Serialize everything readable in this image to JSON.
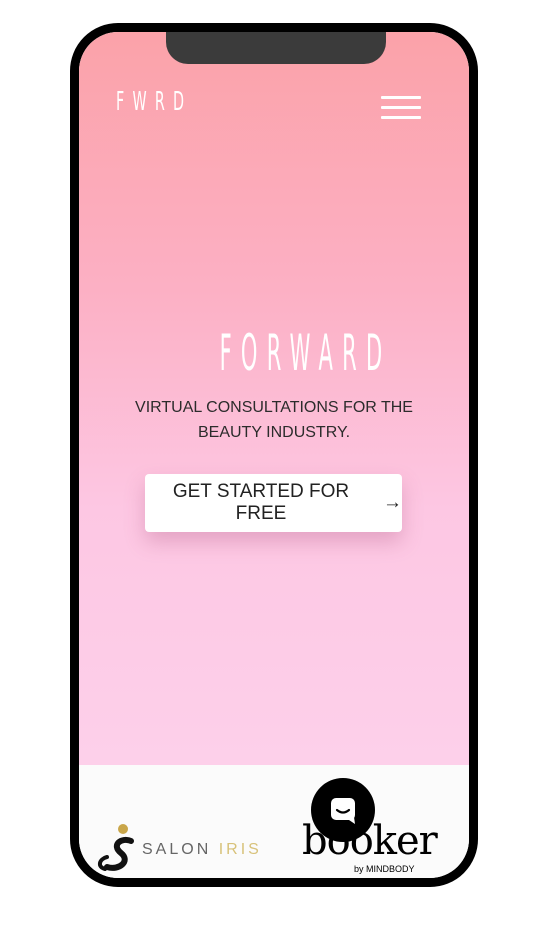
{
  "header": {
    "logo": "FWRD",
    "menu_icon": "hamburger-menu-icon"
  },
  "hero": {
    "title": "FORWARD",
    "tagline_line1": "VIRTUAL CONSULTATIONS FOR THE",
    "tagline_line2": "BEAUTY INDUSTRY.",
    "cta_label": "GET STARTED FOR FREE",
    "cta_arrow": "→"
  },
  "partners": {
    "salon_iris_part1": "SALON ",
    "salon_iris_part2": "IRIS",
    "booker_name": "booker",
    "booker_sub": "by MINDBODY"
  },
  "chat": {
    "icon": "chat-bubble-icon"
  },
  "colors": {
    "gradient_top": "#fba2a9",
    "gradient_bottom": "#fdd0ea",
    "iris_gold": "#d8c27a"
  }
}
